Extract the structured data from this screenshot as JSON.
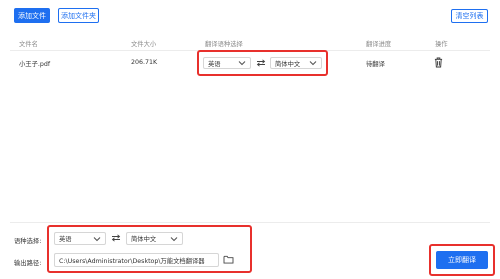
{
  "toolbar": {
    "add_file": "添加文件",
    "add_folder": "添加文件夹",
    "clear_list": "清空列表"
  },
  "table": {
    "headers": {
      "file_name": "文件名",
      "file_size": "文件大小",
      "language": "翻译语种选择",
      "progress": "翻译进度",
      "action": "操作"
    },
    "rows": [
      {
        "file_name": "小王子.pdf",
        "file_size": "206.71K",
        "source_lang": "英语",
        "target_lang": "简体中文",
        "status": "待翻译"
      }
    ]
  },
  "bottom": {
    "language_label": "语种选择:",
    "source_lang": "英语",
    "target_lang": "简体中文",
    "output_label": "输出路径:",
    "output_path": "C:\\Users\\Administrator\\Desktop\\万能文档翻译器",
    "translate_button": "立即翻译"
  },
  "colors": {
    "primary": "#1e6ff0",
    "highlight": "#e8302c"
  }
}
